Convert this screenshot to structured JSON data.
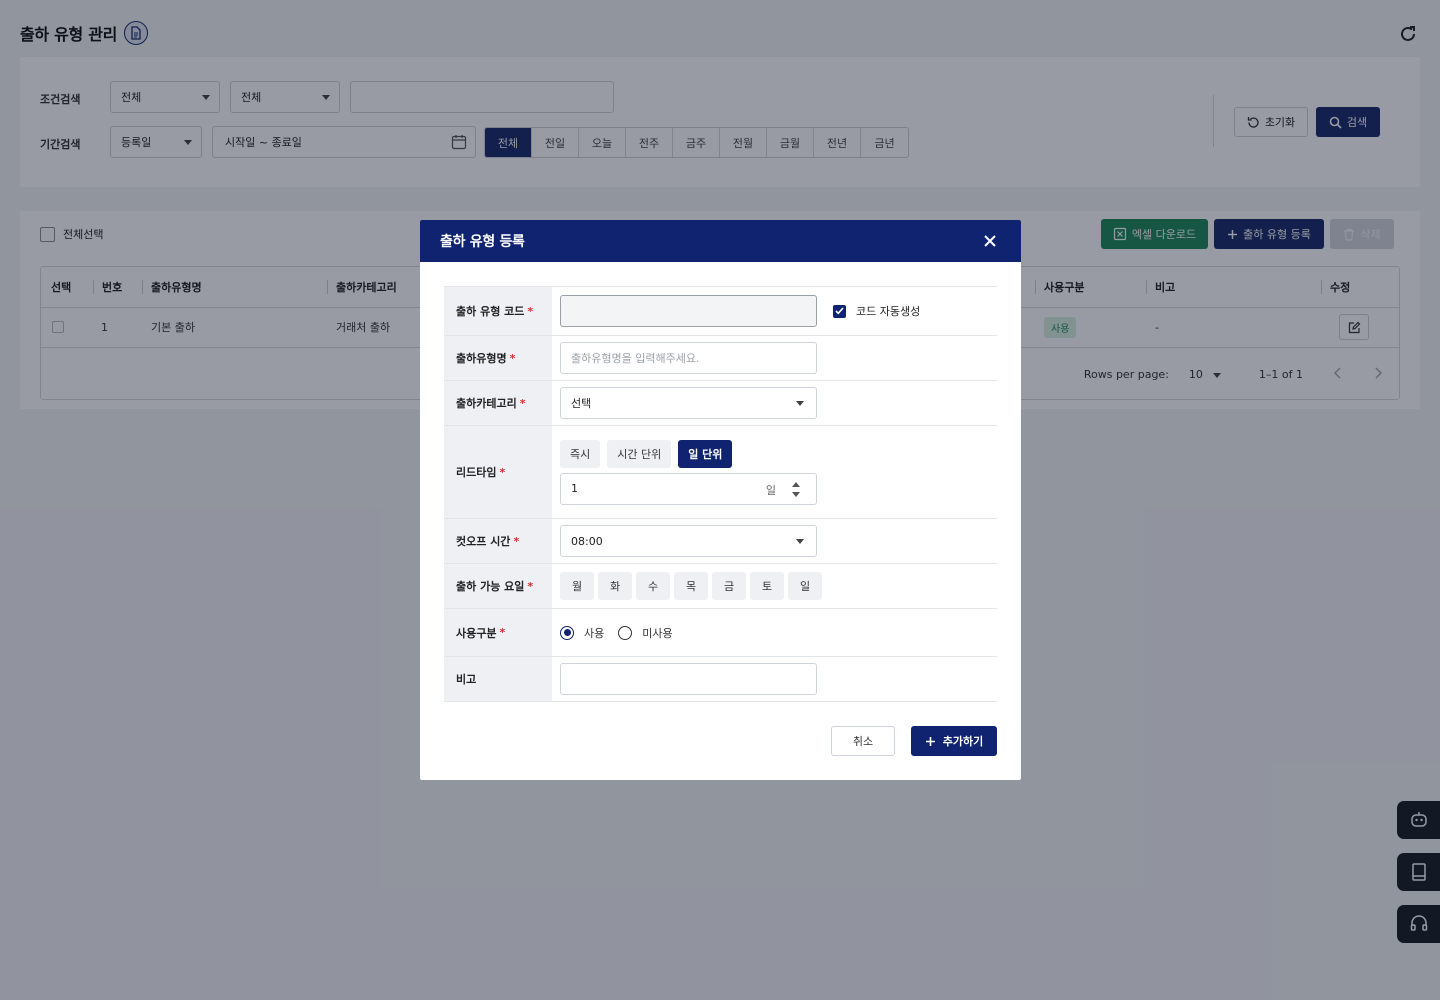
{
  "page": {
    "title": "출하 유형 관리"
  },
  "search": {
    "condition_label": "조건검색",
    "condition_select_1": "전체",
    "condition_select_2": "전체",
    "condition_text": "",
    "period_label": "기간검색",
    "period_select": "등록일",
    "date_range": "시작일 ~ 종료일",
    "period_buttons": [
      "전체",
      "전일",
      "오늘",
      "전주",
      "금주",
      "전월",
      "금월",
      "전년",
      "금년"
    ],
    "period_active": "전체",
    "reset_label": "초기화",
    "search_label": "검색"
  },
  "list": {
    "select_all_label": "전체선택",
    "excel_label": "엑셀 다운로드",
    "register_label": "출하 유형 등록",
    "delete_label": "삭제",
    "columns": {
      "select": "선택",
      "number": "번호",
      "type_name": "출하유형명",
      "category": "출하카테고리",
      "usage": "사용구분",
      "note": "비고",
      "edit": "수정"
    },
    "rows": [
      {
        "number": "1",
        "type_name": "기본 출하",
        "category": "거래처 출하",
        "usage": "사용",
        "note": "-"
      }
    ],
    "pagination": {
      "rows_per_page_label": "Rows per page:",
      "rows_per_page": "10",
      "range": "1–1 of 1"
    }
  },
  "modal": {
    "title": "출하 유형 등록",
    "fields": {
      "code": {
        "label": "출하 유형 코드",
        "value": "",
        "auto_label": "코드 자동생성",
        "auto_checked": true
      },
      "name": {
        "label": "출하유형명",
        "placeholder": "출하유형명을 입력해주세요."
      },
      "category": {
        "label": "출하카테고리",
        "value": "선택"
      },
      "lead_time": {
        "label": "리드타임",
        "options": [
          "즉시",
          "시간 단위",
          "일 단위"
        ],
        "active": "일 단위",
        "value": "1",
        "unit": "일"
      },
      "cutoff": {
        "label": "컷오프 시간",
        "value": "08:00"
      },
      "days": {
        "label": "출하 가능 요일",
        "options": [
          "월",
          "화",
          "수",
          "목",
          "금",
          "토",
          "일"
        ]
      },
      "usage": {
        "label": "사용구분",
        "options": [
          "사용",
          "미사용"
        ],
        "selected": "사용"
      },
      "note": {
        "label": "비고",
        "value": ""
      }
    },
    "required_mark": "*",
    "cancel_label": "취소",
    "submit_label": "추가하기"
  },
  "colors": {
    "primary": "#0f2370",
    "excel": "#1f8a5c",
    "required": "#d32f2f"
  }
}
